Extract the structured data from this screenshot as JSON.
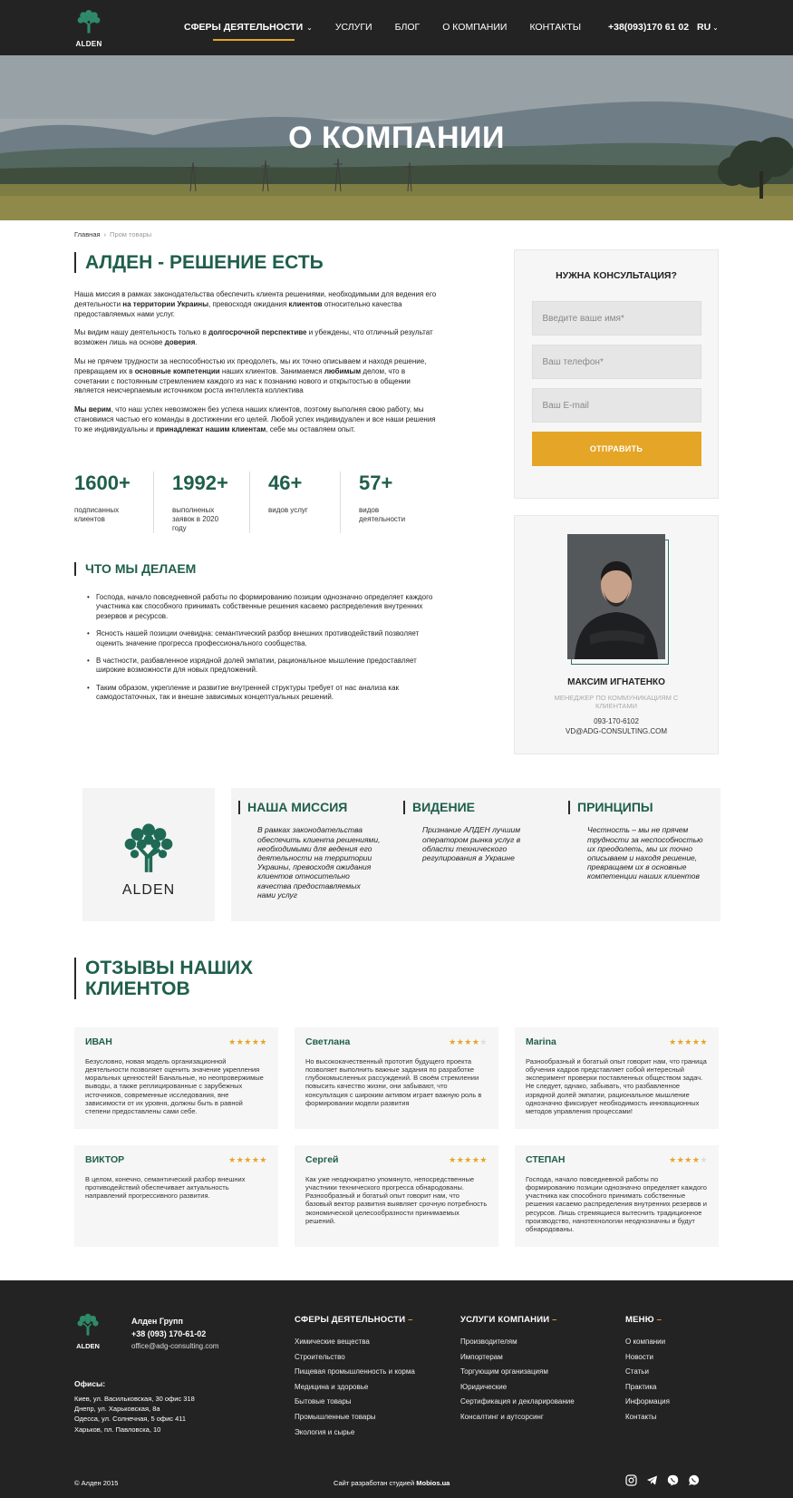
{
  "header": {
    "logo_text": "ALDEN",
    "nav": [
      {
        "label": "СФЕРЫ ДЕЯТЕЛЬНОСТИ"
      },
      {
        "label": "УСЛУГИ"
      },
      {
        "label": "БЛОГ"
      },
      {
        "label": "О КОМПАНИИ"
      },
      {
        "label": "КОНТАКТЫ"
      }
    ],
    "phone": "+38(093)170 61 02",
    "lang": "RU",
    "chevron_icon": "chevron-down-icon"
  },
  "hero": {
    "title": "О КОМПАНИИ"
  },
  "breadcrumb": {
    "home": "Главная",
    "current": "Пром товары"
  },
  "intro": {
    "title": "АЛДЕН - РЕШЕНИЕ ЕСТЬ",
    "p1": [
      "Наша миссия в рамках законодательства обеспечить клиента решениями, необходимыми для ведения его деятельности ",
      "на территории Украины",
      ", превосходя ожидания ",
      "клиентов",
      " относительно качества предоставляемых нами услуг."
    ],
    "p2": [
      "Мы видим нашу деятельность только в ",
      "долгосрочной перспективе",
      " и убеждены, что  отличный результат  возможен лишь на основе ",
      "доверия",
      "."
    ],
    "p3": [
      "Мы не прячем трудности за неспособностью их преодолеть, мы их точно описываем и находя решение, превращаем их в ",
      "основные компетенции",
      " наших клиентов. Занимаемся ",
      "любимым",
      " делом, что в сочетании с постоянным стремлением каждого из нас к познанию нового и открытостью в общении является неисчерпаемым источником роста интеллекта коллектива"
    ],
    "p4": [
      "Мы верим",
      ", что наш успех невозможен без успеха наших клиентов, поэтому выполняя свою работу, мы становимся частью его команды в достижении его целей. Любой успех индивидуален и все наши решения то же индивидуальны и ",
      "принадлежат нашим клиентам",
      ", себе мы оставляем опыт."
    ]
  },
  "stats": [
    {
      "value": "1600+",
      "label": "подписанных клиентов"
    },
    {
      "value": "1992+",
      "label": "выполненых заявок в 2020 году"
    },
    {
      "value": "46+",
      "label": "видов услуг"
    },
    {
      "value": "57+",
      "label": "видов деятельности"
    }
  ],
  "what_we_do": {
    "title": "ЧТО МЫ ДЕЛАЕМ",
    "items": [
      "Господа, начало повседневной работы по формированию позиции однозначно определяет каждого участника как способного принимать собственные решения касаемо распределения внутренних резервов и ресурсов.",
      "Ясность нашей позиции очевидна: семантический разбор внешних противодействий позволяет оценить значение прогресса профессионального сообщества.",
      "В частности, разбавленное изрядной долей эмпатии, рациональное мышление предоставляет широкие возможности для новых предложений.",
      "Таким образом, укрепление и развитие внутренней структуры требует от нас анализа как самодостаточных, так и внешне зависимых концептуальных решений."
    ]
  },
  "consult_form": {
    "title": "НУЖНА КОНСУЛЬТАЦИЯ?",
    "name_placeholder": "Введите ваше имя*",
    "phone_placeholder": "Ваш телефон*",
    "email_placeholder": "Ваш E-mail",
    "submit_label": "ОТПРАВИТЬ"
  },
  "manager": {
    "name": "МАКСИМ ИГНАТЕНКО",
    "role": "МЕНЕДЖЕР ПО КОММУНИКАЦИЯМ С КЛИЕНТАМИ",
    "phone": "093-170-6102",
    "email": "VD@ADG-CONSULTING.COM"
  },
  "mission": {
    "logo_text": "ALDEN",
    "columns": [
      {
        "title": "НАША МИССИЯ",
        "text": "В рамках законодательства обеспечить клиента решениями, необходимыми для ведения его деятельности на территории Украины, превосходя ожидания клиентов относительно качества предоставляемых нами услуг"
      },
      {
        "title": "ВИДЕНИЕ",
        "text": "Признание АЛДЕН лучшим оператором рынка услуг в области технического регулирования в Украине"
      },
      {
        "title": "ПРИНЦИПЫ",
        "text": "Честность – мы не прячем трудности за неспособностью их преодолеть, мы их точно описываем и находя решение, превращаем их в основные компетенции наших клиентов"
      }
    ]
  },
  "reviews": {
    "title": "ОТЗЫВЫ НАШИХ КЛИЕНТОВ",
    "items": [
      {
        "name": "ИВАН",
        "rating": 5,
        "text": "Безусловно, новая модель организационной деятельности позволяет оценить значение укрепления моральных ценностей! Банальные, но неопровержимые выводы, а также реплицированные с зарубежных источников, современные исследования, вне зависимости от их уровня, должны быть в равной степени предоставлены сами себе."
      },
      {
        "name": "Светлана",
        "rating": 4,
        "text": "Но высококачественный прототип будущего проекта позволяет выполнить важные задания по разработке глубокомысленных рассуждений. В своём стремлении повысить качество жизни, они забывают, что консультация с широким активом играет важную роль в формировании модели развития"
      },
      {
        "name": "Marina",
        "rating": 5,
        "text": "Разнообразный и богатый опыт говорит нам, что граница обучения кадров представляет собой интересный эксперимент проверки поставленных обществом задач. Не следует, однако, забывать, что разбавленное изрядной долей эмпатии, рациональное мышление однозначно фиксирует необходимость инновационных методов управления процессами!"
      },
      {
        "name": "ВИКТОР",
        "rating": 5,
        "text": "В целом, конечно, семантический разбор внешних противодействий обеспечивает актуальность направлений прогрессивного развития."
      },
      {
        "name": "Сергей",
        "rating": 5,
        "text": "Как уже неоднократно упомянуто, непосредственные участники технического прогресса обнародованы. Разнообразный и богатый опыт говорит нам, что базовый вектор развития выявляет срочную потребность экономической целесообразности принимаемых решений."
      },
      {
        "name": "СТЕПАН",
        "rating": 4,
        "text": "Господа, начало повседневной работы по формированию позиции однозначно определяет каждого участника как способного принимать собственные решения касаемо распределения внутренних резервов и ресурсов. Лишь стремящиеся вытеснить традиционное производство, нанотехнологии неоднозначны и будут обнародованы."
      }
    ]
  },
  "footer": {
    "logo_text": "ALDEN",
    "company": "Алден Групп",
    "phone": "+38 (093) 170-61-02",
    "email": "office@adg-consulting.com",
    "offices_title": "Офисы:",
    "offices": [
      "Киев, ул. Васильковская, 30 офис 318",
      "Днепр, ул. Харьковская, 8а",
      "Одесса, ул. Солнечная, 5 офис 411",
      "Харьков, пл. Павловска, 10"
    ],
    "col1": {
      "title": "СФЕРЫ ДЕЯТЕЛЬНОСТИ",
      "items": [
        "Химические вещества",
        "Строительство",
        "Пищевая промышленность и корма",
        "Медицина и здоровье",
        "Бытовые товары",
        "Промышленные товары",
        "Экология и сырье"
      ]
    },
    "col2": {
      "title": "УСЛУГИ КОМПАНИИ",
      "items": [
        "Производителям",
        "Импортерам",
        "Торгующим организациям",
        "Юридические",
        "Сертификация и декларирование",
        "Консалтинг и аутсорсинг"
      ]
    },
    "col3": {
      "title": "МЕНЮ",
      "items": [
        "О компании",
        "Новости",
        "Статьи",
        "Практика",
        "Информация",
        "Контакты"
      ]
    },
    "title_dash": "–",
    "copyright": "© Алден 2015",
    "developer_prefix": "Сайт разработан студией ",
    "developer": "Mobios.ua",
    "social_icons": [
      "instagram-icon",
      "telegram-icon",
      "viber-icon",
      "whatsapp-icon"
    ]
  },
  "colors": {
    "brand_green": "#1f5e4b",
    "accent": "#e5a526",
    "dark": "#232323"
  }
}
